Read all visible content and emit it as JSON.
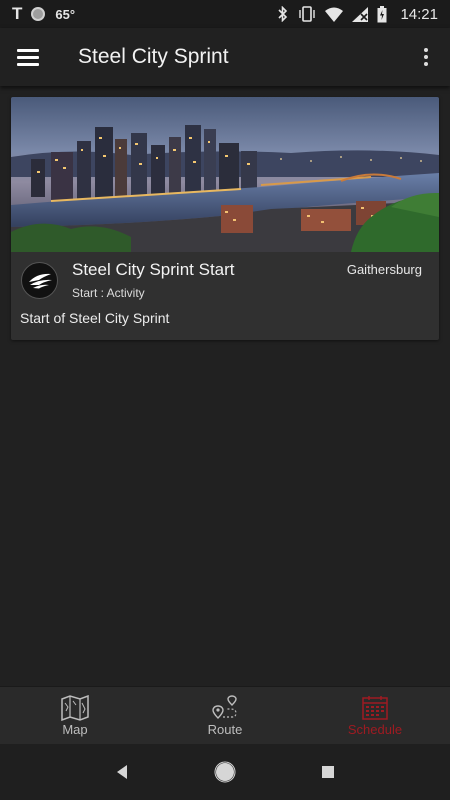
{
  "status_bar": {
    "temperature": "65°",
    "time": "14:21",
    "carrier_glyph": "T"
  },
  "app_bar": {
    "title": "Steel City Sprint"
  },
  "event_card": {
    "title": "Steel City Sprint Start",
    "subtitle": "Start : Activity",
    "location": "Gaithersburg",
    "description": "Start of Steel City Sprint",
    "image_icon": "city-skyline-image"
  },
  "bottom_nav": {
    "items": [
      {
        "label": "Map",
        "icon": "map-icon",
        "active": false
      },
      {
        "label": "Route",
        "icon": "route-icon",
        "active": false
      },
      {
        "label": "Schedule",
        "icon": "calendar-icon",
        "active": true
      }
    ],
    "active_color": "#9e1b22"
  },
  "system_nav": {
    "back": "back-icon",
    "home": "home-icon",
    "recents": "recents-icon"
  }
}
